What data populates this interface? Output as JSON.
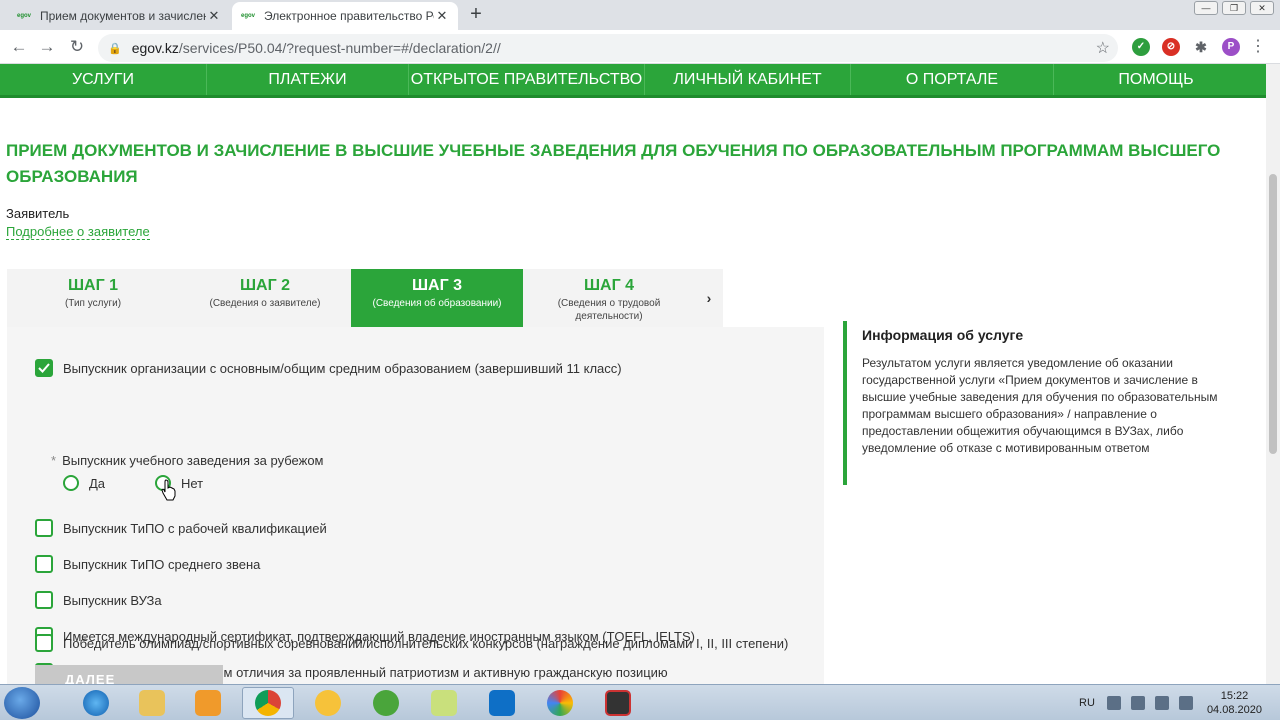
{
  "browser": {
    "tabs": [
      {
        "favicon": "egov",
        "title": "Прием документов и зачислени",
        "active": false
      },
      {
        "favicon": "egov",
        "title": "Электронное правительство Ре",
        "active": true
      }
    ],
    "url_host": "egov.kz",
    "url_path": "/services/P50.04/?request-number=#/declaration/2//",
    "profile_initial": "P"
  },
  "nav": {
    "items": [
      "УСЛУГИ",
      "ПЛАТЕЖИ",
      "ОТКРЫТОЕ ПРАВИТЕЛЬСТВО",
      "ЛИЧНЫЙ КАБИНЕТ",
      "О ПОРТАЛЕ",
      "ПОМОЩЬ"
    ]
  },
  "page": {
    "title": "ПРИЕМ ДОКУМЕНТОВ И ЗАЧИСЛЕНИЕ В ВЫСШИЕ УЧЕБНЫЕ ЗАВЕДЕНИЯ ДЛЯ ОБУЧЕНИЯ ПО ОБРАЗОВАТЕЛЬНЫМ ПРОГРАММАМ ВЫСШЕГО ОБРАЗОВАНИЯ",
    "applicant_label": "Заявитель",
    "applicant_link": "Подробнее о заявителе"
  },
  "steps": [
    {
      "num": "ШАГ 1",
      "label": "(Тип услуги)"
    },
    {
      "num": "ШАГ 2",
      "label": "(Сведения о заявителе)"
    },
    {
      "num": "ШАГ 3",
      "label": "(Сведения об образовании)"
    },
    {
      "num": "ШАГ 4",
      "label": "(Сведения о трудовой деятельности)"
    }
  ],
  "active_step": 3,
  "form": {
    "options": [
      {
        "label": "Выпускник организации с основным/общим средним образованием (завершивший 11 класс)",
        "checked": true
      },
      {
        "label": "Выпускник ТиПО с рабочей квалификацией",
        "checked": false
      },
      {
        "label": "Выпускник ТиПО среднего звена",
        "checked": false
      },
      {
        "label": "Выпускник ВУЗа",
        "checked": false
      },
      {
        "label": "Имеется международный сертификат, подтверждающий владение иностранным языком (TOEFL, IELTS)",
        "checked": false
      },
      {
        "label": "Лицо, награжденное знаком отличия за проявленный патриотизм и активную гражданскую позицию",
        "checked": false
      },
      {
        "label": "Победитель олимпиад/спортивных соревнований/исполнительских конкурсов (награждение дипломами I, II, III степени)",
        "checked": false
      }
    ],
    "abroad_question": "Выпускник учебного заведения за рубежом",
    "required_mark": "*",
    "radio_yes": "Да",
    "radio_no": "Нет",
    "next_button": "ДАЛЕЕ"
  },
  "info": {
    "heading": "Информация об услуге",
    "text": "Результатом услуги является уведомление об оказании государственной услуги «Прием документов и зачисление в высшие учебные заведения для обучения по образовательным программам высшего образования» / направление о предоставлении общежития обучающимся в ВУЗах, либо уведомление об отказе с мотивированным ответом"
  },
  "taskbar": {
    "lang": "RU",
    "time": "15:22",
    "date": "04.08.2020"
  },
  "colors": {
    "brand": "#2ba53a"
  }
}
